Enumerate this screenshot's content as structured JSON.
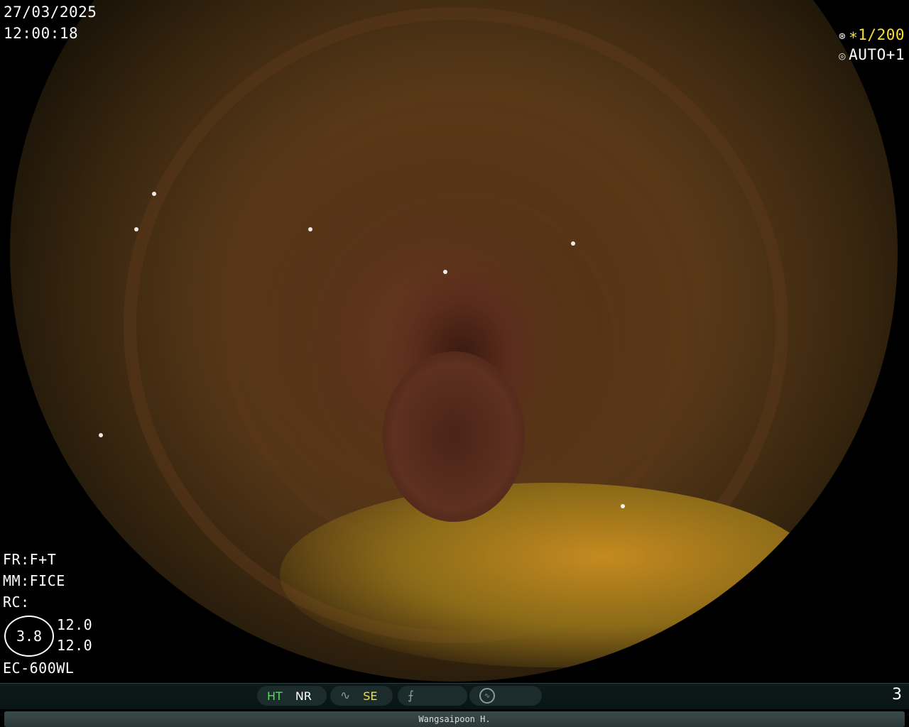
{
  "overlay": {
    "date": "27/03/2025",
    "time": "12:00:18",
    "shutter": "∗1/200",
    "shutter_icon": "shutter-icon",
    "exposure": "AUTO+1",
    "exposure_icon": "iris-icon",
    "fr": "FR:F+T",
    "mm": "MM:FICE",
    "rc": "RC:",
    "ring_value": "3.8",
    "value_top": "12.0",
    "value_bottom": "12.0",
    "scope_model": "EC-600WL"
  },
  "statusbar": {
    "ht": "HT",
    "nr": "NR",
    "se": "SE",
    "page": "3",
    "colors": {
      "ht": "#55dd55",
      "se": "#ffdd33",
      "inactive": "#8a9a9a"
    }
  },
  "patient": {
    "name": "Wangsaipoon H."
  }
}
